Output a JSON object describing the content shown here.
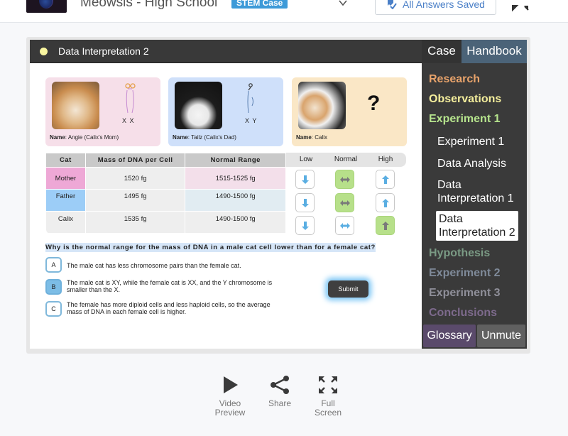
{
  "header": {
    "app_title": "Meowsis - High School",
    "badge": "STEM Case",
    "saved_status": "All Answers Saved",
    "icons": {
      "dropdown": "chevron-down-icon",
      "saved": "check-icon",
      "expand": "expand-icon"
    }
  },
  "activity": {
    "title": "Data Interpretation 2",
    "status_color": "#f9f6a0"
  },
  "sidebar": {
    "tabs": [
      {
        "label": "Case"
      },
      {
        "label": "Handbook"
      }
    ],
    "sections": [
      {
        "label": "Research",
        "color": "#e8a36b"
      },
      {
        "label": "Observations",
        "color": "#f4ee9c"
      },
      {
        "label": "Experiment 1",
        "color": "#b6e48d"
      },
      {
        "label": "Hypothesis",
        "color": "#7a9a84"
      },
      {
        "label": "Experiment 2",
        "color": "#7f8a99"
      },
      {
        "label": "Experiment 3",
        "color": "#8f8f99"
      },
      {
        "label": "Conclusions",
        "color": "#7d6a8c"
      }
    ],
    "sub_items": [
      {
        "label": "Experiment 1"
      },
      {
        "label": "Data Analysis"
      },
      {
        "label": "Data Interpretation 1"
      },
      {
        "label": "Data Interpretation 2",
        "active": true
      }
    ],
    "buttons": {
      "glossary": "Glossary",
      "unmute": "Unmute"
    }
  },
  "cats": [
    {
      "name_label": "Name",
      "name": "Angie (Calix's Mom)",
      "chromosomes": "X X"
    },
    {
      "name_label": "Name",
      "name": "Tailz (Calix's Dad)",
      "chromosomes": "X Y"
    },
    {
      "name_label": "Name",
      "name": "Calix",
      "chromosomes": "?"
    }
  ],
  "table": {
    "headers": [
      "Cat",
      "Mass of DNA per Cell",
      "Normal Range",
      "Low",
      "Normal",
      "High"
    ],
    "rows": [
      {
        "cat": "Mother",
        "mass": "1520 fg",
        "range": "1515-1525 fg",
        "selected": "Normal"
      },
      {
        "cat": "Father",
        "mass": "1495 fg",
        "range": "1490-1500 fg",
        "selected": "Normal"
      },
      {
        "cat": "Calix",
        "mass": "1535 fg",
        "range": "1490-1500 fg",
        "selected": "High"
      }
    ]
  },
  "question": {
    "text": "Why is the normal range for the mass of DNA in a male cat cell lower than for a female cat?",
    "options": [
      {
        "letter": "A",
        "text": "The male cat has less chromosome pairs than the female cat."
      },
      {
        "letter": "B",
        "text": "The male cat is XY, while the female cat is XX, and the Y chromosome is smaller than the X.",
        "selected": true
      },
      {
        "letter": "C",
        "text": "The female has more diploid cells and less haploid cells, so the average mass of DNA in each female cell is higher."
      }
    ],
    "submit_label": "Submit"
  },
  "bottom_toolbar": [
    {
      "label_line1": "Video",
      "label_line2": "Preview",
      "icon": "play-icon"
    },
    {
      "label_line1": "Share",
      "label_line2": "",
      "icon": "share-icon"
    },
    {
      "label_line1": "Full",
      "label_line2": "Screen",
      "icon": "fullscreen-icon"
    }
  ]
}
